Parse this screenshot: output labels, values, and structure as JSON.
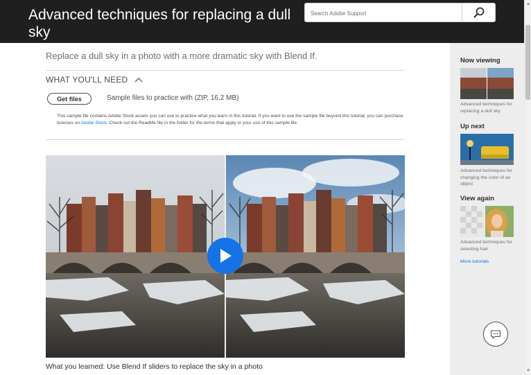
{
  "header": {
    "title": "Advanced techniques for replacing a dull sky",
    "search_placeholder": "Search Adobe Support"
  },
  "main": {
    "intro": "Replace a dull sky in a photo with a more dramatic sky with Blend If.",
    "need_toggle_label": "WHAT YOU'LL NEED",
    "get_files_label": "Get files",
    "sample_desc": "Sample files to practice with (ZIP, 16.2 MB)",
    "license_note_before": "This sample file contains Adobe Stock assets you can use to practice what you learn in this tutorial. If you want to use the sample file beyond this tutorial, you can purchase licenses on",
    "license_link": "Adobe Stock",
    "license_note_after": ". Check out the ReadMe file in the folder for the terms that apply to your use of this sample file.",
    "caption": "What you learned: Use Blend If sliders to replace the sky in a photo"
  },
  "sidebar": {
    "now_viewing": {
      "heading": "Now viewing",
      "title": "Advanced techniques for replacing a dull sky"
    },
    "up_next": {
      "heading": "Up next",
      "title": "Advanced techniques for changing the color of an object"
    },
    "view_again": {
      "heading": "View again",
      "title": "Advanced techniques for selecting hair"
    },
    "more_link": "More tutorials"
  },
  "colors": {
    "header_bg": "#1f1f1f",
    "accent": "#1473e6",
    "sidebar_bg": "#ededed"
  },
  "icons": {
    "search": "search-icon",
    "chevron": "chevron-up-icon",
    "play": "play-icon",
    "chat": "chat-icon"
  }
}
